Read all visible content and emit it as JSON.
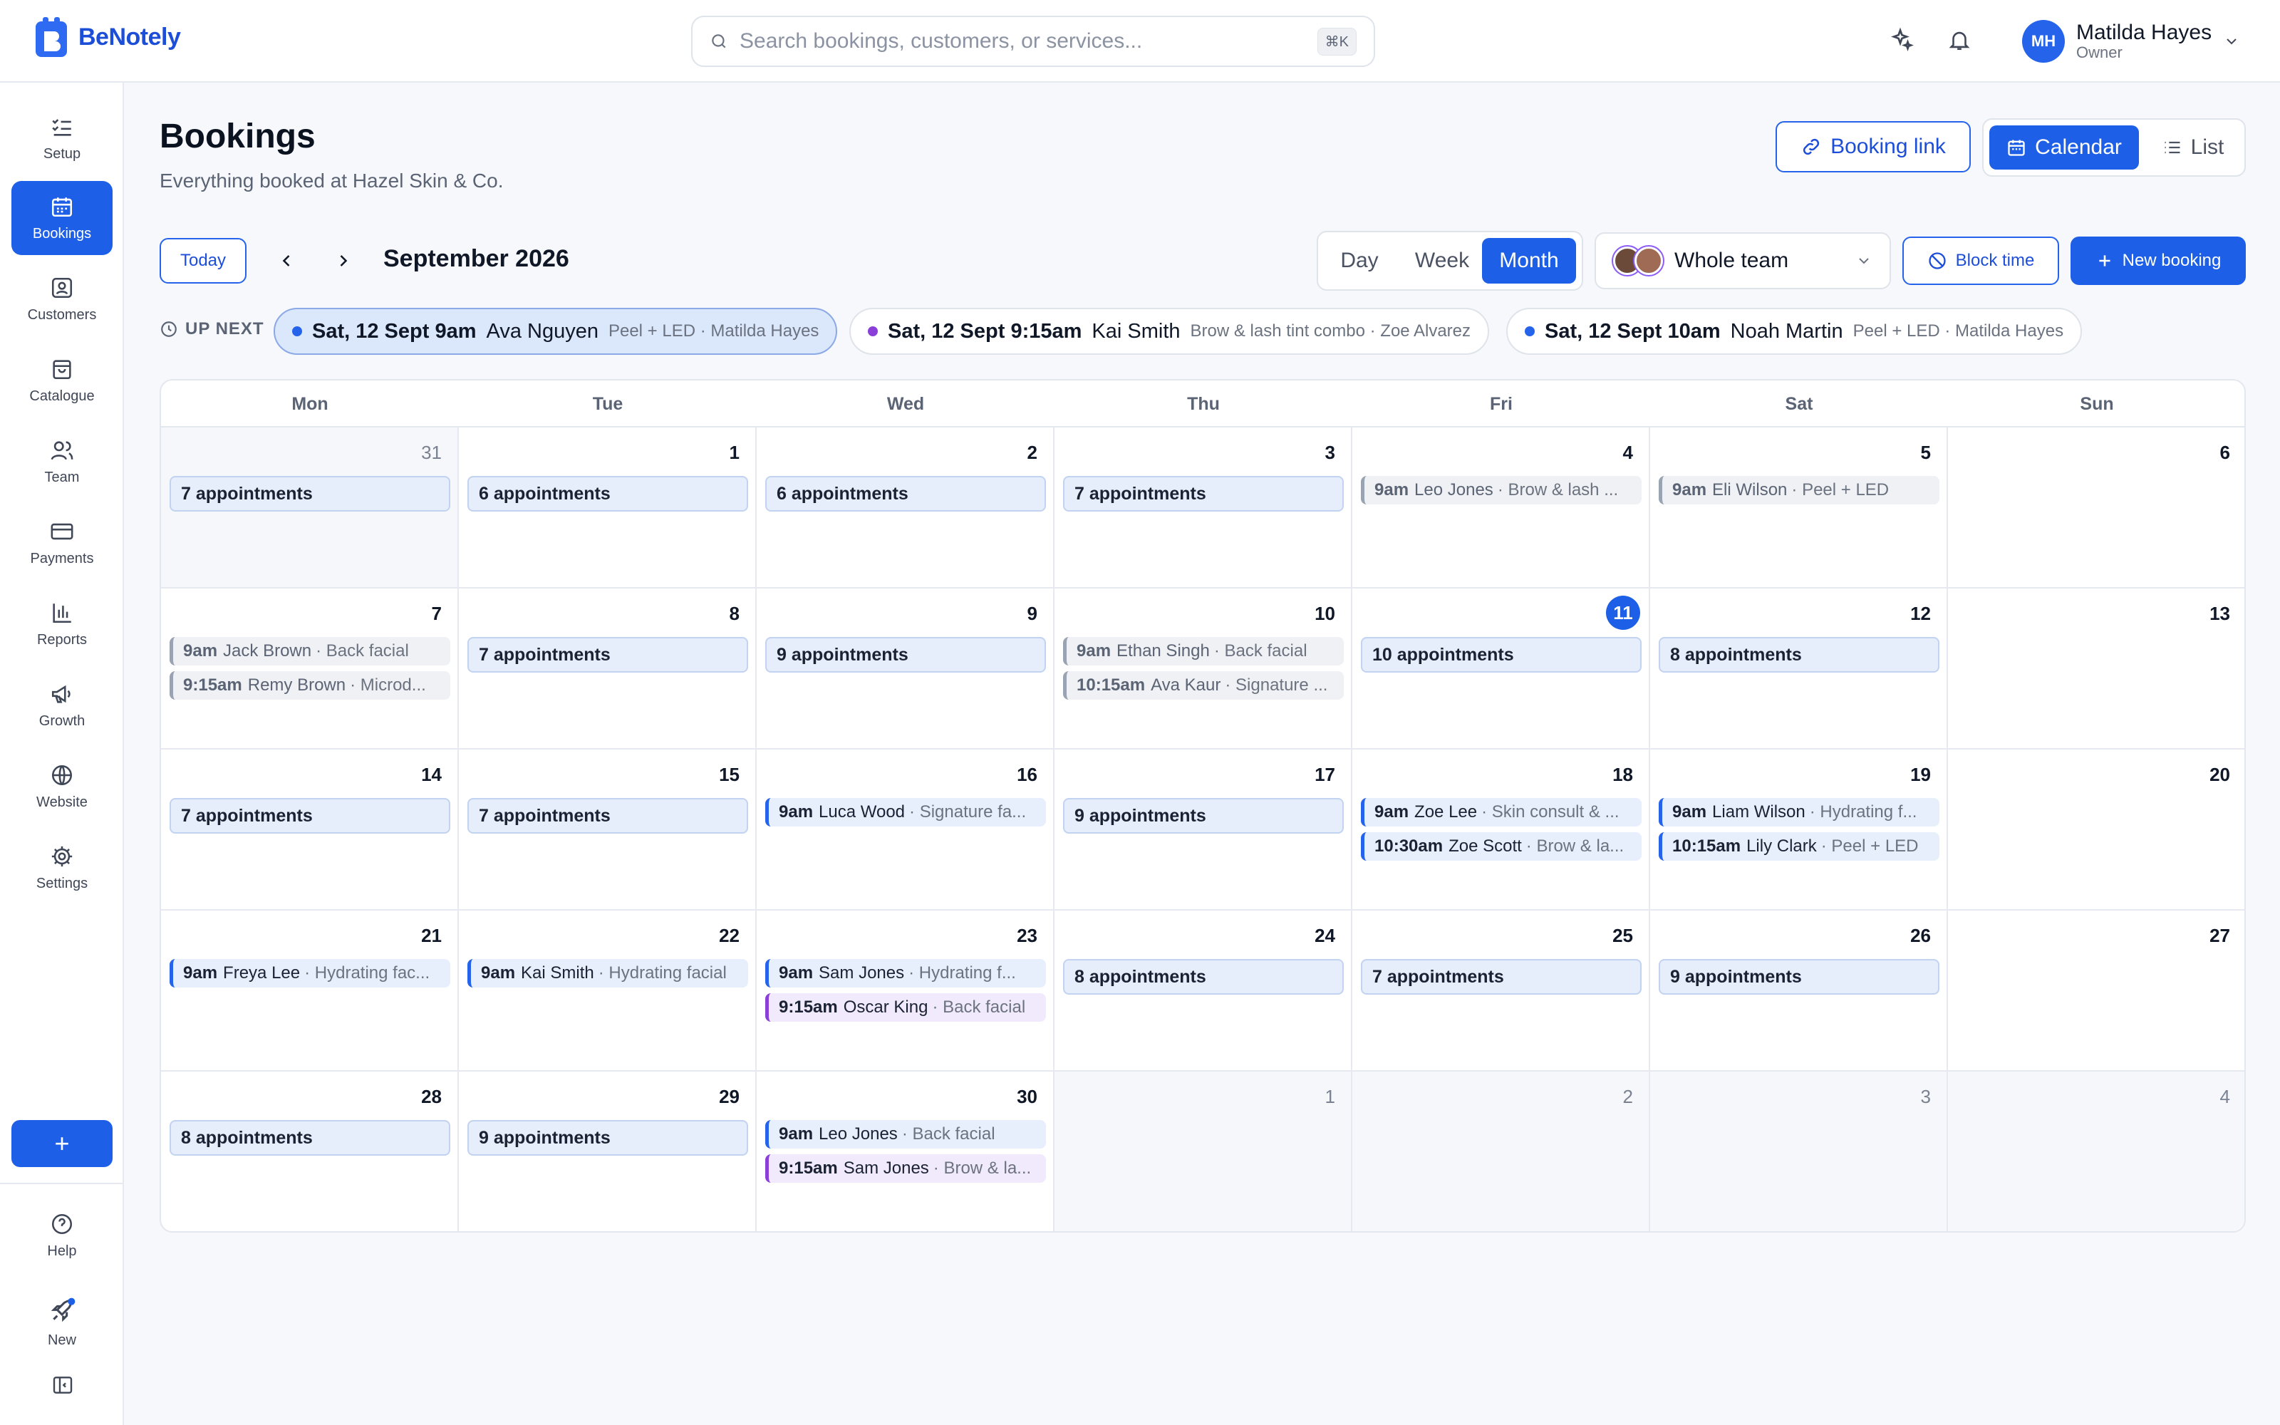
{
  "app": {
    "brand": "BeNotely"
  },
  "search": {
    "placeholder": "Search bookings, customers, or services...",
    "shortcut": "⌘K"
  },
  "user": {
    "initials": "MH",
    "name": "Matilda Hayes",
    "role": "Owner"
  },
  "sidebar": {
    "items": [
      {
        "label": "Setup",
        "icon": "checklist-icon"
      },
      {
        "label": "Bookings",
        "icon": "calendar-icon",
        "active": true
      },
      {
        "label": "Customers",
        "icon": "contact-card-icon"
      },
      {
        "label": "Catalogue",
        "icon": "bag-icon"
      },
      {
        "label": "Team",
        "icon": "people-icon"
      },
      {
        "label": "Payments",
        "icon": "card-icon"
      },
      {
        "label": "Reports",
        "icon": "bar-chart-icon"
      },
      {
        "label": "Growth",
        "icon": "megaphone-icon"
      },
      {
        "label": "Website",
        "icon": "globe-icon"
      },
      {
        "label": "Settings",
        "icon": "gear-icon"
      }
    ],
    "plus_label": "+",
    "help_label": "Help",
    "new_label": "New"
  },
  "header": {
    "title": "Bookings",
    "subtitle": "Everything booked at Hazel Skin & Co.",
    "booking_link": "Booking link",
    "view_calendar": "Calendar",
    "view_list": "List"
  },
  "toolbar": {
    "today": "Today",
    "month_label": "September 2026",
    "views": [
      "Day",
      "Week",
      "Month"
    ],
    "active_view": "Month",
    "team": "Whole team",
    "block_time": "Block time",
    "new_booking": "New booking"
  },
  "up_next": {
    "label": "UP NEXT",
    "items": [
      {
        "when": "Sat, 12 Sept 9am",
        "who": "Ava Nguyen",
        "what": "Peel + LED · Matilda Hayes",
        "color": "#2563eb"
      },
      {
        "when": "Sat, 12 Sept 9:15am",
        "who": "Kai Smith",
        "what": "Brow & lash tint combo · Zoe Alvarez",
        "color": "#8b3fd9"
      },
      {
        "when": "Sat, 12 Sept 10am",
        "who": "Noah Martin",
        "what": "Peel + LED · Matilda Hayes",
        "color": "#2563eb"
      }
    ]
  },
  "calendar": {
    "weekdays": [
      "Mon",
      "Tue",
      "Wed",
      "Thu",
      "Fri",
      "Sat",
      "Sun"
    ],
    "weeks": [
      [
        {
          "day": "31",
          "muted": true,
          "summary": "7 appointments"
        },
        {
          "day": "1",
          "summary": "6 appointments"
        },
        {
          "day": "2",
          "summary": "6 appointments"
        },
        {
          "day": "3",
          "summary": "7 appointments"
        },
        {
          "day": "4",
          "events": [
            {
              "time": "9am",
              "name": "Leo Jones",
              "service": "Brow & lash ...",
              "kind": "past"
            }
          ]
        },
        {
          "day": "5",
          "events": [
            {
              "time": "9am",
              "name": "Eli Wilson",
              "service": "Peel + LED",
              "kind": "past"
            }
          ]
        },
        {
          "day": "6"
        }
      ],
      [
        {
          "day": "7",
          "events": [
            {
              "time": "9am",
              "name": "Jack Brown",
              "service": "Back facial",
              "kind": "past"
            },
            {
              "time": "9:15am",
              "name": "Remy Brown",
              "service": "Microd...",
              "kind": "past"
            }
          ]
        },
        {
          "day": "8",
          "summary": "7 appointments"
        },
        {
          "day": "9",
          "summary": "9 appointments"
        },
        {
          "day": "10",
          "events": [
            {
              "time": "9am",
              "name": "Ethan Singh",
              "service": "Back facial",
              "kind": "past"
            },
            {
              "time": "10:15am",
              "name": "Ava Kaur",
              "service": "Signature ...",
              "kind": "past"
            }
          ]
        },
        {
          "day": "11",
          "today": true,
          "summary": "10 appointments"
        },
        {
          "day": "12",
          "summary": "8 appointments"
        },
        {
          "day": "13"
        }
      ],
      [
        {
          "day": "14",
          "summary": "7 appointments"
        },
        {
          "day": "15",
          "summary": "7 appointments"
        },
        {
          "day": "16",
          "events": [
            {
              "time": "9am",
              "name": "Luca Wood",
              "service": "Signature fa...",
              "kind": "blue"
            }
          ]
        },
        {
          "day": "17",
          "summary": "9 appointments"
        },
        {
          "day": "18",
          "events": [
            {
              "time": "9am",
              "name": "Zoe Lee",
              "service": "Skin consult & ...",
              "kind": "blue"
            },
            {
              "time": "10:30am",
              "name": "Zoe Scott",
              "service": "Brow & la...",
              "kind": "blue"
            }
          ]
        },
        {
          "day": "19",
          "events": [
            {
              "time": "9am",
              "name": "Liam Wilson",
              "service": "Hydrating f...",
              "kind": "blue"
            },
            {
              "time": "10:15am",
              "name": "Lily Clark",
              "service": "Peel + LED",
              "kind": "blue"
            }
          ]
        },
        {
          "day": "20"
        }
      ],
      [
        {
          "day": "21",
          "events": [
            {
              "time": "9am",
              "name": "Freya Lee",
              "service": "Hydrating fac...",
              "kind": "blue"
            }
          ]
        },
        {
          "day": "22",
          "events": [
            {
              "time": "9am",
              "name": "Kai Smith",
              "service": "Hydrating facial",
              "kind": "blue"
            }
          ]
        },
        {
          "day": "23",
          "events": [
            {
              "time": "9am",
              "name": "Sam Jones",
              "service": "Hydrating f...",
              "kind": "blue"
            },
            {
              "time": "9:15am",
              "name": "Oscar King",
              "service": "Back facial",
              "kind": "purple"
            }
          ]
        },
        {
          "day": "24",
          "summary": "8 appointments"
        },
        {
          "day": "25",
          "summary": "7 appointments"
        },
        {
          "day": "26",
          "summary": "9 appointments"
        },
        {
          "day": "27"
        }
      ],
      [
        {
          "day": "28",
          "summary": "8 appointments"
        },
        {
          "day": "29",
          "summary": "9 appointments"
        },
        {
          "day": "30",
          "events": [
            {
              "time": "9am",
              "name": "Leo Jones",
              "service": "Back facial",
              "kind": "blue"
            },
            {
              "time": "9:15am",
              "name": "Sam Jones",
              "service": "Brow & la...",
              "kind": "purple"
            }
          ]
        },
        {
          "day": "1",
          "muted": true
        },
        {
          "day": "2",
          "muted": true
        },
        {
          "day": "3",
          "muted": true
        },
        {
          "day": "4",
          "muted": true
        }
      ]
    ]
  },
  "colors": {
    "accent": "#1d5fe6",
    "purple": "#8b3fd9"
  }
}
